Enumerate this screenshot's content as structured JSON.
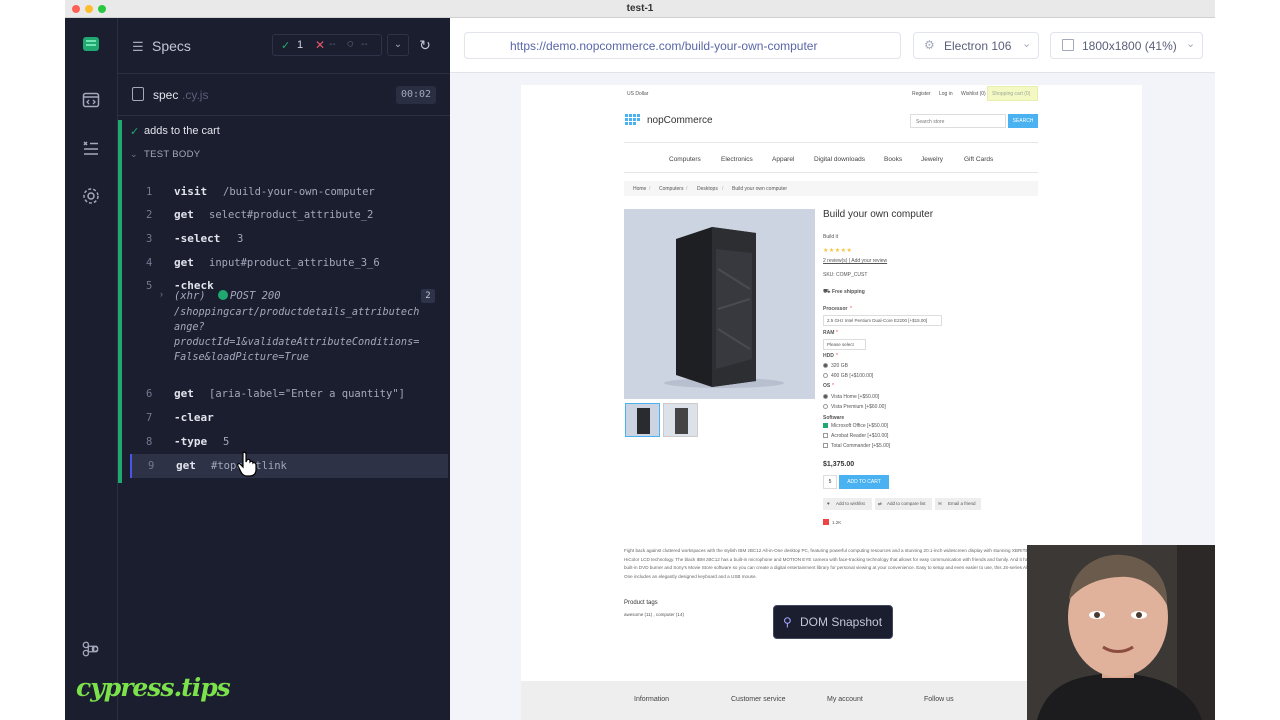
{
  "window": {
    "title": "test-1"
  },
  "colors": {
    "accent_green": "#1fa971",
    "sidebar_bg": "#1b1e2e",
    "site_button": "#4ab2f1",
    "cypress_tips": "#7be24b"
  },
  "sidebar": {
    "icons": [
      "cypress-logo-icon",
      "specs-list-icon",
      "runs-icon",
      "settings-icon",
      "keyboard-shortcuts-icon"
    ]
  },
  "runner": {
    "specs_label": "Specs",
    "stats": {
      "passed": "1",
      "failed": "--",
      "pending": "--"
    },
    "spec_name": "spec",
    "spec_ext": ".cy.js",
    "duration": "00:02",
    "test_title": "adds to the cart",
    "hook_label": "TEST BODY",
    "commands": [
      {
        "num": "1",
        "name": "visit",
        "arg": "/build-your-own-computer"
      },
      {
        "num": "2",
        "name": "get",
        "arg": "select#product_attribute_2"
      },
      {
        "num": "3",
        "name": "-select",
        "arg": "3"
      },
      {
        "num": "4",
        "name": "get",
        "arg": "input#product_attribute_3_6"
      },
      {
        "num": "5",
        "name": "-check",
        "arg": ""
      },
      {
        "num": "6",
        "name": "get",
        "arg": "[aria-label=\"Enter a quantity\"]"
      },
      {
        "num": "7",
        "name": "-clear",
        "arg": ""
      },
      {
        "num": "8",
        "name": "-type",
        "arg": "5"
      },
      {
        "num": "9",
        "name": "get",
        "arg": "#topcartlink"
      }
    ],
    "xhr": {
      "label": "(xhr)",
      "status": "POST 200",
      "count": "2",
      "lines": [
        "/shoppingcart/productdetails_attributech",
        "ange?",
        "productId=1&validateAttributeConditions=",
        "False&loadPicture=True"
      ]
    },
    "watermark": "cypress.tips"
  },
  "aut": {
    "url": "https://demo.nopcommerce.com/build-your-own-computer",
    "browser": "Electron 106",
    "viewport": "1800x1800 (41%)",
    "snapshot_label": "DOM Snapshot"
  },
  "site": {
    "currency": "US Dollar",
    "header_links": [
      "Register",
      "Log in",
      "Wishlist (0)"
    ],
    "cart": "Shopping cart (0)",
    "logo": "nopCommerce",
    "search_placeholder": "Search store",
    "search_button": "SEARCH",
    "menu": [
      "Computers",
      "Electronics",
      "Apparel",
      "Digital downloads",
      "Books",
      "Jewelry",
      "Gift Cards"
    ],
    "breadcrumb": [
      "Home",
      "Computers",
      "Desktops",
      "Build your own computer"
    ],
    "product_title": "Build your own computer",
    "short_desc": "Build it",
    "reviews": "2 review(s) | Add your review",
    "sku_label": "SKU:",
    "sku": "COMP_CUST",
    "free_shipping": "Free shipping",
    "processor_label": "Processor",
    "processor_value": "2.5 GHz Intel Pentium Dual-Core E2200 [+$15.00]",
    "ram_label": "RAM",
    "ram_value": "Please select",
    "hdd_label": "HDD",
    "hdd_options": [
      "320 GB",
      "400 GB [+$100.00]"
    ],
    "os_label": "OS",
    "os_options": [
      "Vista Home [+$50.00]",
      "Vista Premium [+$60.00]"
    ],
    "software_label": "Software",
    "software_options": [
      "Microsoft Office [+$50.00]",
      "Acrobat Reader [+$10.00]",
      "Total Commander [+$5.00]"
    ],
    "price": "$1,375.00",
    "qty": "5",
    "add_to_cart": "ADD TO CART",
    "actions": [
      "Add to wishlist",
      "Add to compare list",
      "Email a friend"
    ],
    "share_count": "1.2K",
    "full_desc": "Fight back against cluttered workspaces with the stylish IBM zBC12 All-in-One desktop PC, featuring powerful computing resources and a stunning 20.1-inch widescreen display with stunning XBRITE-HiColor LCD technology. The black IBM zBC12 has a built-in microphone and MOTION EYE camera with face-tracking technology that allows for easy communication with friends and family. And it has a built-in DVD burner and Sony's Movie Store software so you can create a digital entertainment library for personal viewing at your convenience. Easy to setup and even easier to use, this JS-series All-in-One includes an elegantly designed keyboard and a USB mouse.",
    "tags_title": "Product tags",
    "tags": "awesome (11) , computer (14)",
    "footer": [
      "Information",
      "Customer service",
      "My account",
      "Follow us"
    ]
  }
}
